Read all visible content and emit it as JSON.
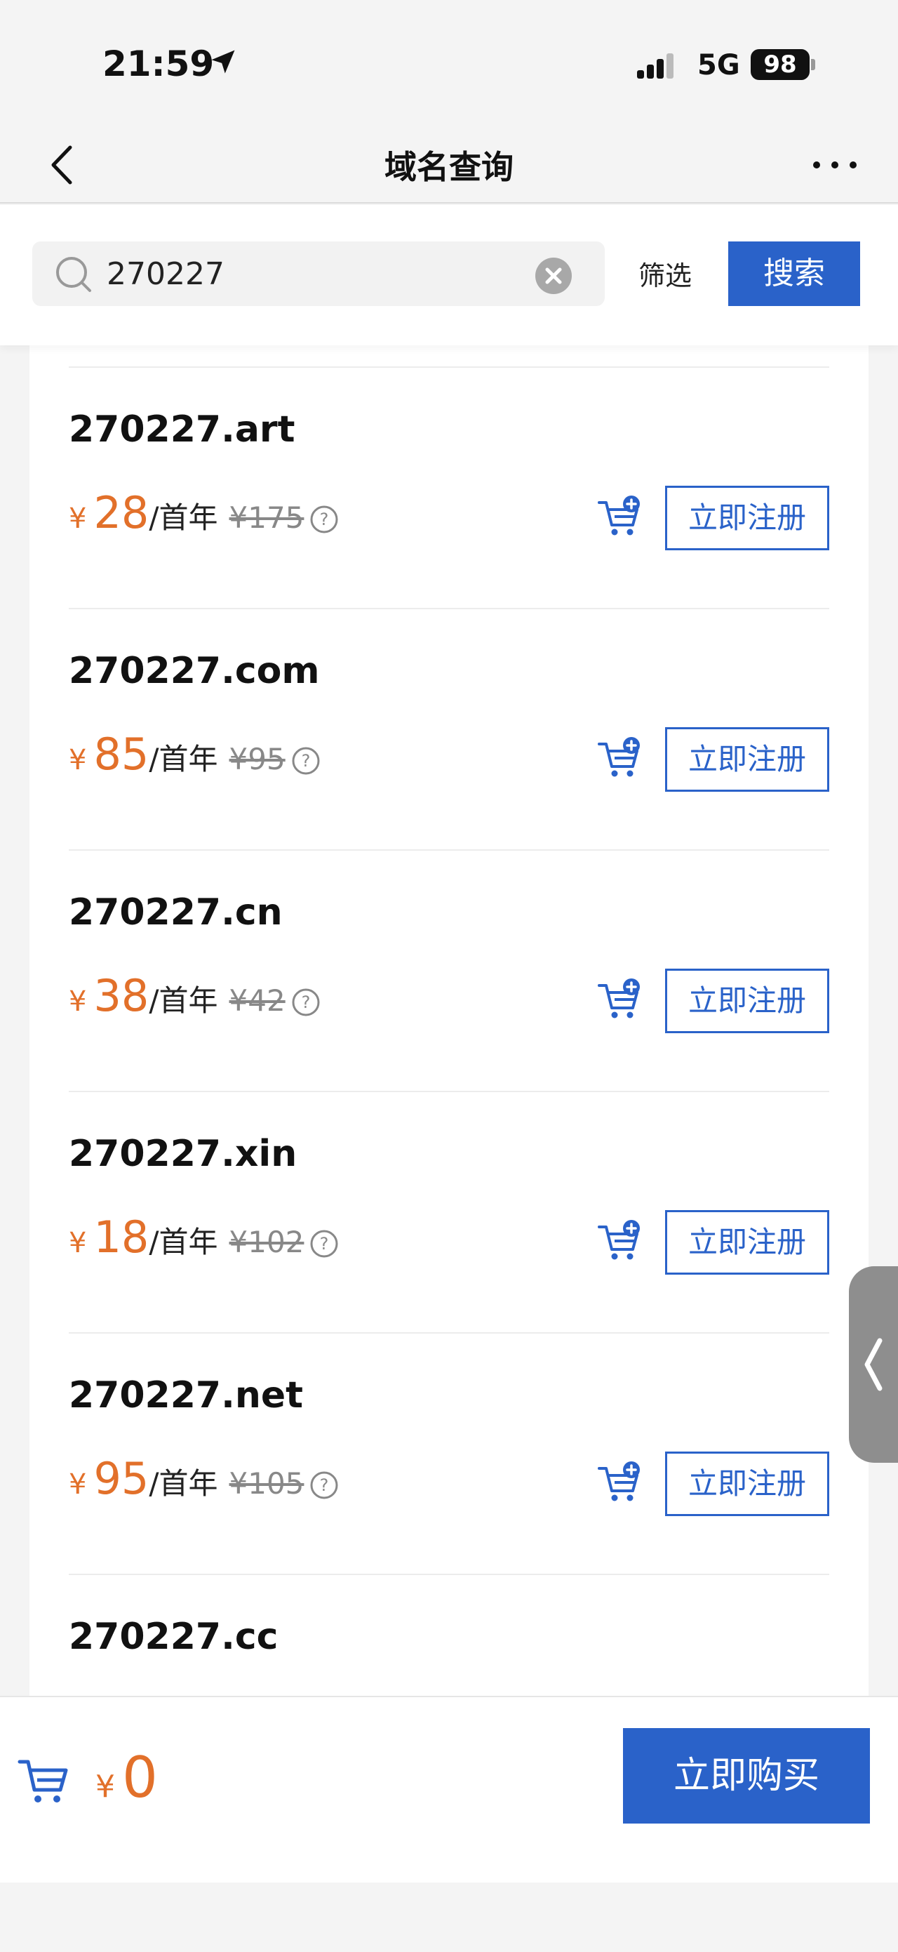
{
  "status": {
    "time": "21:59",
    "network": "5G",
    "battery": "98"
  },
  "header": {
    "title": "域名查询"
  },
  "search": {
    "value": "270227",
    "filter_label": "筛选",
    "search_label": "搜索"
  },
  "common": {
    "currency": "¥",
    "per_year": "/首年",
    "register_label": "立即注册"
  },
  "domains": [
    {
      "name": "270227.art",
      "price": "28",
      "original": "¥175"
    },
    {
      "name": "270227.com",
      "price": "85",
      "original": "¥95"
    },
    {
      "name": "270227.cn",
      "price": "38",
      "original": "¥42"
    },
    {
      "name": "270227.xin",
      "price": "18",
      "original": "¥102"
    },
    {
      "name": "270227.net",
      "price": "95",
      "original": "¥105"
    },
    {
      "name": "270227.cc"
    }
  ],
  "cart": {
    "total": "0",
    "buy_label": "立即购买"
  },
  "colors": {
    "accent": "#2a62c9",
    "price": "#e2702a"
  }
}
